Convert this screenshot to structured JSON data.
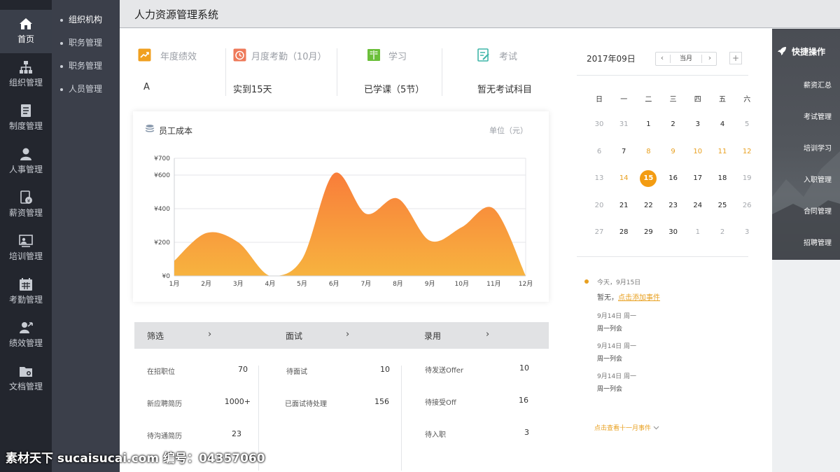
{
  "header": {
    "title": "人力资源管理系统"
  },
  "nav": {
    "items": [
      {
        "label": "首页",
        "icon": "home-icon"
      },
      {
        "label": "组织管理",
        "icon": "org-chart-icon"
      },
      {
        "label": "制度管理",
        "icon": "document-icon"
      },
      {
        "label": "人事管理",
        "icon": "person-icon"
      },
      {
        "label": "薪资管理",
        "icon": "salary-icon"
      },
      {
        "label": "培训管理",
        "icon": "training-icon"
      },
      {
        "label": "考勤管理",
        "icon": "calendar-icon"
      },
      {
        "label": "绩效管理",
        "icon": "performance-icon"
      },
      {
        "label": "文档管理",
        "icon": "folder-icon"
      }
    ],
    "active_index": 0
  },
  "subnav": {
    "items": [
      {
        "label": "组织机构"
      },
      {
        "label": "职务管理"
      },
      {
        "label": "职务管理"
      },
      {
        "label": "人员管理"
      }
    ]
  },
  "stats": [
    {
      "label": "年度绩效",
      "value": "A",
      "icon": "trend-icon",
      "color": "#f0a020"
    },
    {
      "label": "月度考勤（10月）",
      "value": "实到15天",
      "icon": "clock-icon",
      "color": "#ee7a5a"
    },
    {
      "label": "学习",
      "value": "已学课（5节）",
      "icon": "book-icon",
      "color": "#6bbf3a"
    },
    {
      "label": "考试",
      "value": "暂无考试科目",
      "icon": "exam-icon",
      "color": "#3fb6a8"
    }
  ],
  "chart_card": {
    "title": "员工成本",
    "unit": "单位（元）",
    "icon": "coins-icon"
  },
  "chart_data": {
    "type": "area",
    "title": "员工成本",
    "unit": "单位（元）",
    "x": [
      "1月",
      "2月",
      "3月",
      "4月",
      "5月",
      "6月",
      "7月",
      "8月",
      "9月",
      "10月",
      "11月",
      "12月"
    ],
    "y": [
      90,
      255,
      200,
      0,
      100,
      610,
      370,
      460,
      210,
      290,
      400,
      0
    ],
    "ylim": [
      0,
      700
    ],
    "yticks": [
      "¥0",
      "¥200",
      "¥400",
      "¥600",
      "¥700"
    ],
    "ytick_values": [
      0,
      200,
      400,
      600,
      700
    ],
    "grid": true,
    "gradient": [
      "#f97d3a",
      "#f7b33f"
    ]
  },
  "recruit": {
    "columns": [
      {
        "header": "筛选",
        "rows": [
          {
            "label": "在招职位",
            "value": "70"
          },
          {
            "label": "新应聘简历",
            "value": "1000+"
          },
          {
            "label": "待沟通简历",
            "value": "23"
          }
        ]
      },
      {
        "header": "面试",
        "rows": [
          {
            "label": "待面试",
            "value": "10"
          },
          {
            "label": "已面试待处理",
            "value": "156"
          }
        ]
      },
      {
        "header": "录用",
        "rows": [
          {
            "label": "待发送Offer",
            "value": "10"
          },
          {
            "label": "待接受Off",
            "value": "16"
          },
          {
            "label": "待入职",
            "value": "3"
          }
        ]
      }
    ],
    "arrow": "›"
  },
  "calendar": {
    "month_label": "2017年09日",
    "current_label": "当月",
    "prev": "‹",
    "next": "›",
    "add": "+",
    "weekdays": [
      "日",
      "一",
      "二",
      "三",
      "四",
      "五",
      "六"
    ],
    "weeks": [
      [
        "30",
        "31",
        "1",
        "2",
        "3",
        "4",
        "5"
      ],
      [
        "6",
        "7",
        "8",
        "9",
        "10",
        "11",
        "12"
      ],
      [
        "13",
        "14",
        "15",
        "16",
        "17",
        "18",
        "19"
      ],
      [
        "20",
        "21",
        "22",
        "23",
        "24",
        "25",
        "26"
      ],
      [
        "27",
        "28",
        "29",
        "30",
        "1",
        "2",
        "3"
      ]
    ],
    "selected": "15",
    "accent": "#f39c12"
  },
  "events": {
    "today_label": "今天，9月15日",
    "none_label": "暂无，",
    "add_link": "点击添加事件",
    "items": [
      {
        "date": "9月14日  周一",
        "title": "周一列会"
      },
      {
        "date": "9月14日  周一",
        "title": "周一列会"
      },
      {
        "date": "9月14日  周一",
        "title": "周一列会"
      }
    ],
    "more_label": "点击查看十一月事件"
  },
  "quick": {
    "title": "快捷操作",
    "icon": "rocket-icon",
    "items": [
      "薪资汇总",
      "考试管理",
      "培训学习",
      "入职管理",
      "合同管理",
      "招聘管理"
    ]
  },
  "watermark": "素材天下 sucaisucai.com  编号：04357060"
}
